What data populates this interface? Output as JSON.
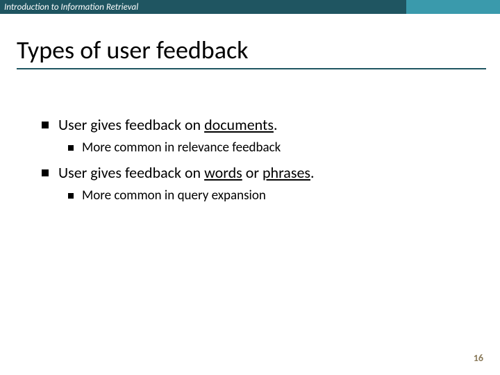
{
  "header": {
    "course": "Introduction to Information Retrieval"
  },
  "title": "Types of user feedback",
  "bullets": [
    {
      "prefix": "User gives feedback on ",
      "underlined": "documents",
      "suffix": ".",
      "sub": "More common in relevance feedback"
    },
    {
      "prefix": "User gives feedback on ",
      "underlined": "words",
      "mid": " or ",
      "underlined2": "phrases",
      "suffix": ".",
      "sub": "More common in query expansion"
    }
  ],
  "pageNumber": "16"
}
